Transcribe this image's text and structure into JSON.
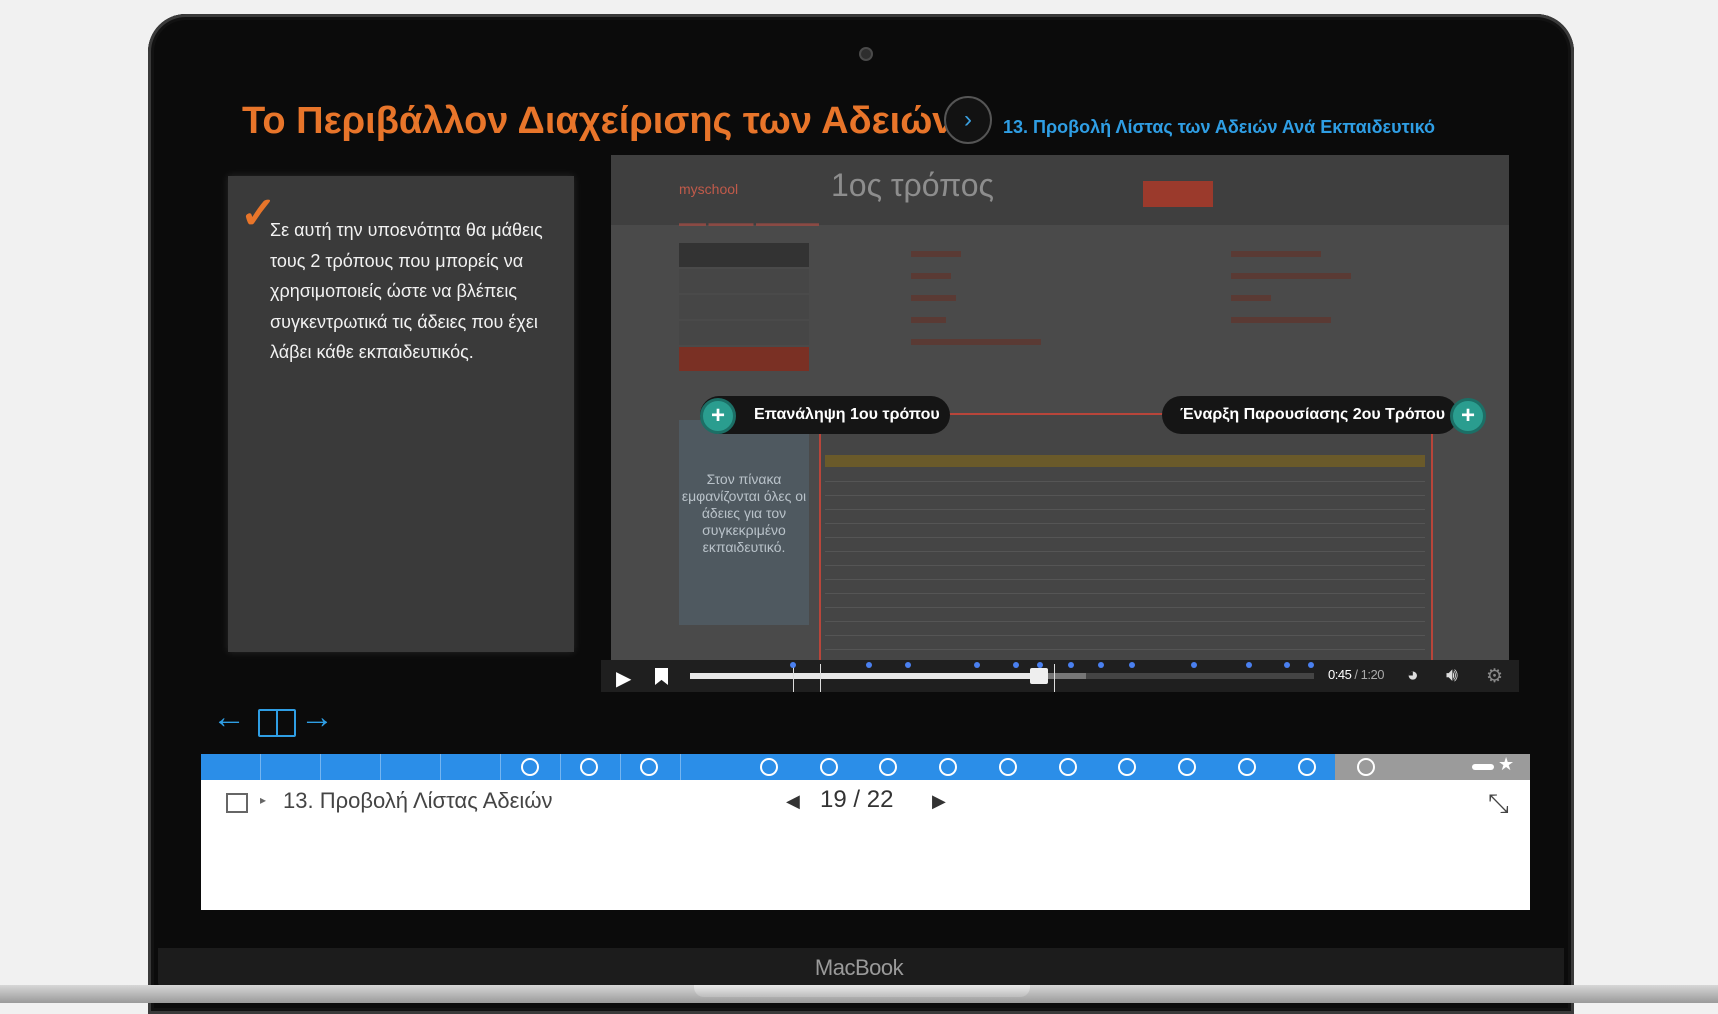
{
  "header": {
    "course_title": "Το Περιβάλλον Διαχείρισης των Αδειών",
    "next_icon": "chevron-right-icon",
    "section_title": "13. Προβολή Λίστας των Αδειών Ανά Εκπαιδευτικό"
  },
  "info_box": {
    "text": "Σε αυτή την υποενότητα θα μάθεις τους 2 τρόπους που μπορείς να χρησιμοποιείς ώστε να βλέπεις συγκεντρωτικά τις άδειες που έχει λάβει κάθε εκπαιδευτικός."
  },
  "video": {
    "overlay_label": "1ος τρόπος",
    "logo_text": "myschool",
    "tip_text": "Στον πίνακα εμφανίζονται όλες οι άδειες για τον συγκεκριμένο εκπαιδευτικό.",
    "left_button": "Επανάληψη 1ου τρόπου",
    "right_button": "Έναρξη Παρουσίασης 2ου Τρόπου"
  },
  "player": {
    "current_time": "0:45",
    "separator": " / ",
    "total_time": "1:20",
    "progress_fraction": 0.5625
  },
  "progress": {
    "fill_fraction": 0.853,
    "fill_color": "#2b8ee8",
    "remaining_color": "#9b9b9b"
  },
  "footer": {
    "slide_title": "13. Προβολή Λίστας Αδειών",
    "current_page": "19",
    "page_separator": "/",
    "total_pages": "22"
  },
  "device": {
    "brand": "MacBook"
  },
  "colors": {
    "accent_orange": "#e8752a",
    "accent_blue": "#2f9ee4",
    "button_teal": "#2a9d8f"
  }
}
